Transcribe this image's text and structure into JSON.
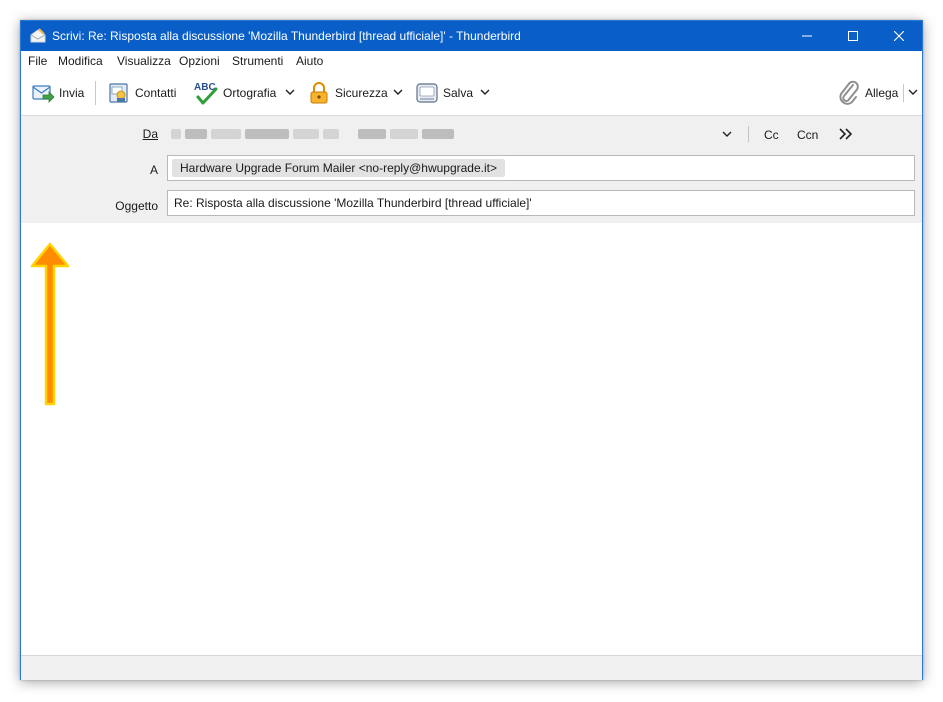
{
  "window": {
    "title": "Scrivi: Re: Risposta alla discussione 'Mozilla Thunderbird [thread ufficiale]' - Thunderbird",
    "controls": [
      "minimize-icon",
      "maximize-icon",
      "close-icon"
    ]
  },
  "menu": {
    "items": [
      {
        "label": "File"
      },
      {
        "label": "Modifica"
      },
      {
        "label": "Visualizza"
      },
      {
        "label": "Opzioni"
      },
      {
        "label": "Strumenti"
      },
      {
        "label": "Aiuto"
      }
    ]
  },
  "toolbar": {
    "send_label": "Invia",
    "contacts_label": "Contatti",
    "spelling_label": "Ortografia",
    "security_label": "Sicurezza",
    "save_label": "Salva",
    "attach_label": "Allega",
    "spelling_icon_text": "ABC"
  },
  "header": {
    "from_label": "Da",
    "to_label": "A",
    "subject_label": "Oggetto",
    "cc_label": "Cc",
    "bcc_label": "Ccn",
    "to_recipient": "Hardware Upgrade Forum Mailer <no-reply@hwupgrade.it>",
    "subject_value": "Re: Risposta alla discussione 'Mozilla Thunderbird [thread ufficiale]'"
  },
  "annotation": {
    "arrow_color": "#ff8c00",
    "arrow_outline": "#ffd400"
  },
  "colors": {
    "titlebar": "#0a5ec8",
    "header_bg": "#f0f0f0"
  }
}
